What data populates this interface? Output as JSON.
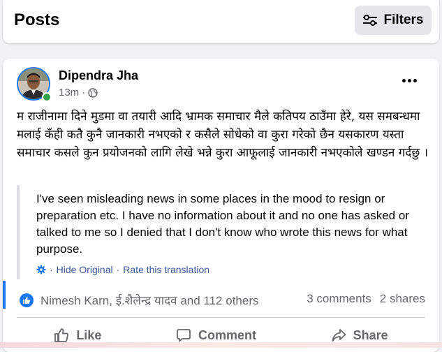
{
  "header": {
    "title": "Posts",
    "filters_label": "Filters"
  },
  "post": {
    "author": "Dipendra Jha",
    "time": "13m",
    "separator": "·",
    "audience_icon": "globe-icon",
    "body": "म राजीनामा दिने मुडमा वा तयारी आदि भ्रामक समाचार मैले कतिपय ठाउँमा हेरे, यस समबन्धमा मलाई कँही कतै कुनै जानकारी नभएको र कसैले सोधेको वा कुरा गरेको छैन यसकारण यस्ता समाचार कसले कुन प्रयोजनको लागि लेखे भन्ने कुरा आफूलाई जानकारी नभएकोले खण्डन गर्दछु ।",
    "translation": "I've seen misleading news in some places in the mood to resign or preparation etc. I have no information about it and no one has asked or talked to me so I denied that I don't know who wrote this news for what purpose.",
    "hide_original": "Hide Original",
    "rate_translation": "Rate this translation",
    "link_separator": "·",
    "reactions_text": "Nimesh Karn, ई.शैलेन्द्र यादव and 112 others",
    "comments": "3 comments",
    "shares": "2 shares"
  },
  "actions": {
    "like": "Like",
    "comment": "Comment",
    "share": "Share"
  },
  "colors": {
    "accent": "#1877f2",
    "link": "#385898",
    "muted": "#65676b",
    "online": "#31a24c"
  }
}
